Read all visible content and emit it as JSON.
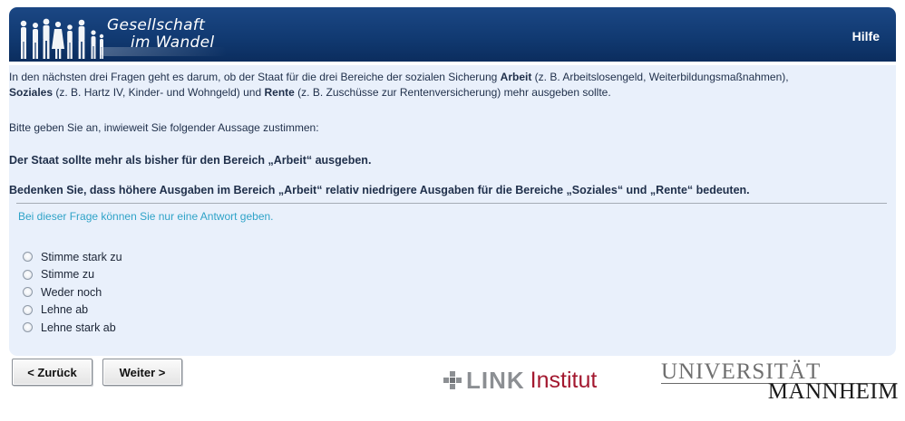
{
  "header": {
    "logo_line1": "Gesellschaft",
    "logo_line2": "im Wandel",
    "help_label": "Hilfe"
  },
  "question": {
    "intro_part1": "In den nächsten drei Fragen geht es darum, ob der Staat für die drei Bereiche der sozialen Sicherung ",
    "intro_arbeit": "Arbeit",
    "intro_part2": " (z. B. Arbeitslosengeld, Weiterbildungsmaßnahmen),",
    "intro_soziales": "Soziales",
    "intro_part3": " (z. B. Hartz IV, Kinder- und Wohngeld) und ",
    "intro_rente": "Rente",
    "intro_part4": " (z. B. Zuschüsse zur Rentenversicherung) mehr ausgeben sollte.",
    "instruction": "Bitte geben Sie an, inwieweit Sie folgender Aussage zustimmen:",
    "statement": "Der Staat sollte mehr als bisher für den Bereich „Arbeit“ ausgeben.",
    "note": "Bedenken Sie, dass höhere Ausgaben im Bereich „Arbeit“ relativ niedrigere Ausgaben für die Bereiche „Soziales“ und „Rente“ bedeuten.",
    "hint": "Bei dieser Frage können Sie nur eine Antwort geben."
  },
  "options": [
    {
      "label": "Stimme stark zu",
      "selected": false
    },
    {
      "label": "Stimme zu",
      "selected": false
    },
    {
      "label": "Weder noch",
      "selected": false
    },
    {
      "label": "Lehne ab",
      "selected": false
    },
    {
      "label": "Lehne stark ab",
      "selected": false
    }
  ],
  "navigation": {
    "back_label": "< Zurück",
    "next_label": "Weiter >"
  },
  "footer": {
    "link_word": "LINK",
    "institut_word": "Institut",
    "university_line1": "UNIVERSITÄT",
    "university_line2": "MANNHEIM"
  },
  "colors": {
    "header_blue": "#123c75",
    "panel_background": "#e9f0fb",
    "hint_color": "#2fa3c8",
    "institut_red": "#a3182f"
  },
  "icons": {
    "logo": "people-silhouettes-icon",
    "link_mark": "link-cross-icon"
  }
}
